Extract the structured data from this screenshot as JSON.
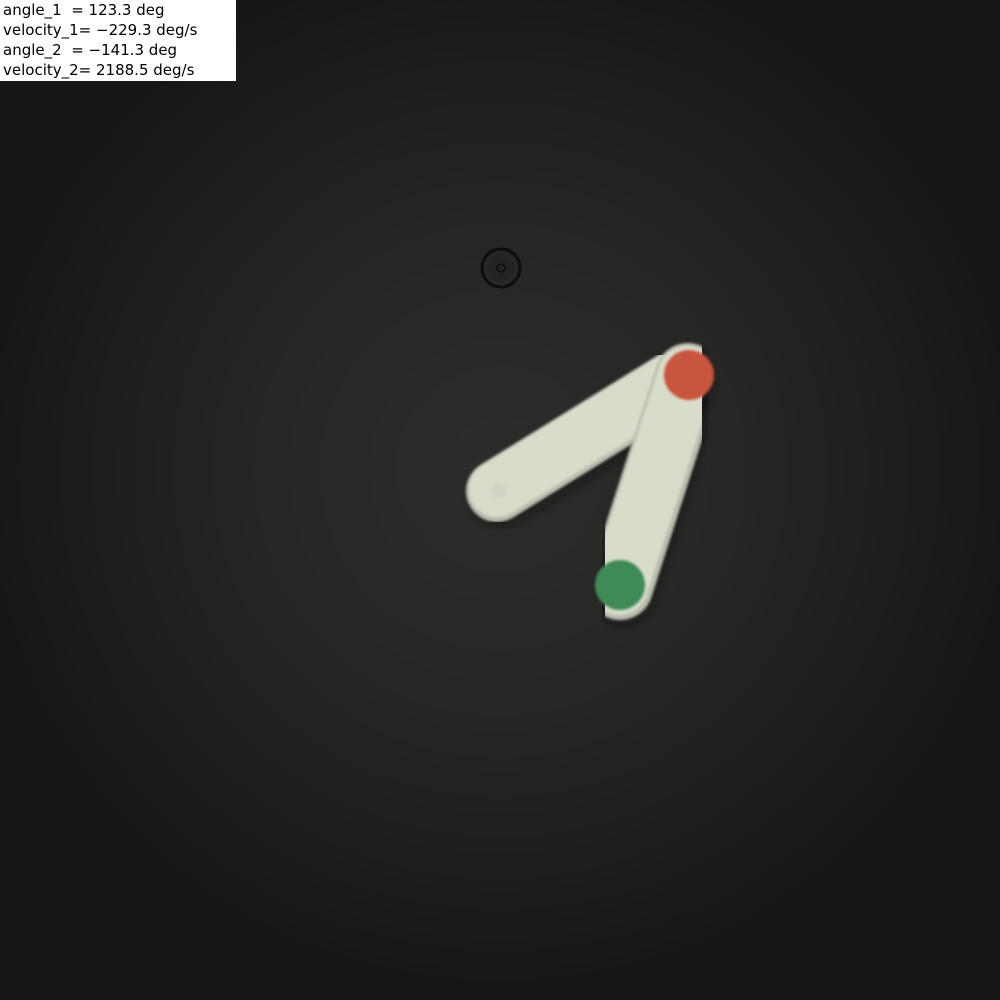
{
  "readout": {
    "angle_1": "angle_1  = 123.3 deg",
    "velocity_1": "velocity_1= −229.3 deg/s",
    "angle_2": "angle_2  = −141.3 deg",
    "velocity_2": "velocity_2= 2188.5 deg/s"
  },
  "colors": {
    "arm": "#d8dccb",
    "upper_joint": "#c8553c",
    "lower_joint": "#3f8a57",
    "pivot_ring": "#0d0d0c"
  }
}
